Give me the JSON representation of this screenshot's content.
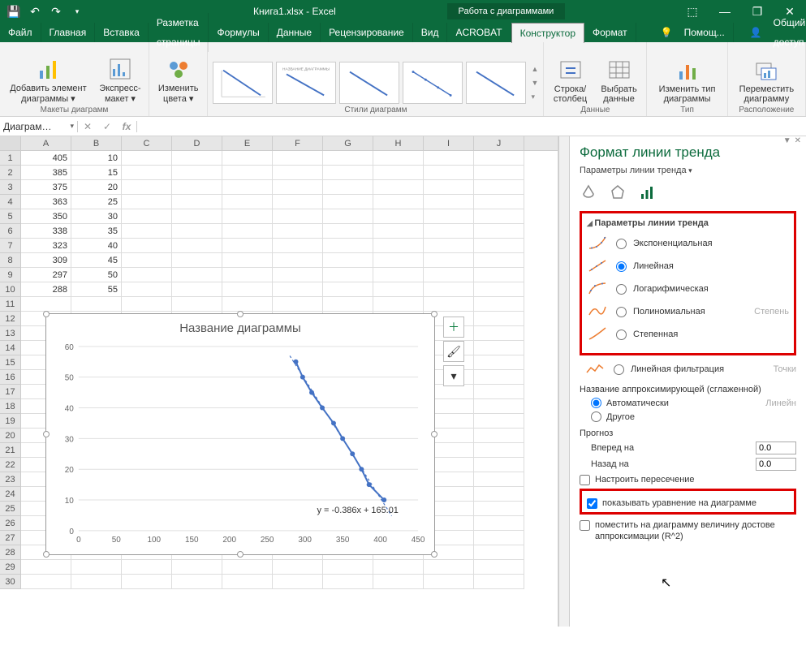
{
  "title": "Книга1.xlsx - Excel",
  "context_title": "Работа с диаграммами",
  "tabs": {
    "file": "Файл",
    "home": "Главная",
    "insert": "Вставка",
    "page_layout": "Разметка страницы",
    "formulas": "Формулы",
    "data": "Данные",
    "review": "Рецензирование",
    "view": "Вид",
    "acrobat": "ACROBAT",
    "design": "Конструктор",
    "format": "Формат",
    "help": "Помощ...",
    "share": "Общий доступ"
  },
  "ribbon": {
    "add_element": "Добавить элемент диаграммы ▾",
    "quick_layout": "Экспресс-макет ▾",
    "layouts": "Макеты диаграмм",
    "change_colors": "Изменить цвета ▾",
    "styles": "Стили диаграмм",
    "switch_row_col": "Строка/столбец",
    "select_data": "Выбрать данные",
    "data_group": "Данные",
    "change_type": "Изменить тип диаграммы",
    "type_group": "Тип",
    "move_chart": "Переместить диаграмму",
    "location_group": "Расположение"
  },
  "namebox": "Диаграм…",
  "chart_data": {
    "type": "scatter",
    "title": "Название диаграммы",
    "xlim": [
      0,
      450
    ],
    "ylim": [
      0,
      60
    ],
    "xticks": [
      0,
      50,
      100,
      150,
      200,
      250,
      300,
      350,
      400,
      450
    ],
    "yticks": [
      0,
      10,
      20,
      30,
      40,
      50,
      60
    ],
    "x": [
      288,
      297,
      309,
      323,
      338,
      350,
      363,
      375,
      385,
      405
    ],
    "y": [
      55,
      50,
      45,
      40,
      35,
      30,
      25,
      20,
      15,
      10
    ],
    "trendline_equation": "y = -0.386x + 165.01"
  },
  "grid": {
    "A": [
      405,
      385,
      375,
      363,
      350,
      338,
      323,
      309,
      297,
      288
    ],
    "B": [
      10,
      15,
      20,
      25,
      30,
      35,
      40,
      45,
      50,
      55
    ]
  },
  "panel": {
    "title": "Формат линии тренда",
    "sub": "Параметры линии тренда",
    "section": "Параметры линии тренда",
    "exponential": "Экспоненциальная",
    "linear": "Линейная",
    "logarithmic": "Логарифмическая",
    "polynomial": "Полиномиальная",
    "polynomial_extra": "Степень",
    "power": "Степенная",
    "moving_avg": "Линейная фильтрация",
    "moving_avg_extra": "Точки",
    "name_label": "Название аппроксимирующей (сглаженной)",
    "automatic": "Автоматически",
    "automatic_right": "Линейн",
    "other": "Другое",
    "forecast": "Прогноз",
    "forward": "Вперед на",
    "backward": "Назад на",
    "forward_val": "0.0",
    "backward_val": "0.0",
    "intercept": "Настроить пересечение",
    "show_eq": "показывать уравнение на диаграмме",
    "show_r2": "поместить на диаграмму величину достове аппроксимации (R^2)"
  }
}
